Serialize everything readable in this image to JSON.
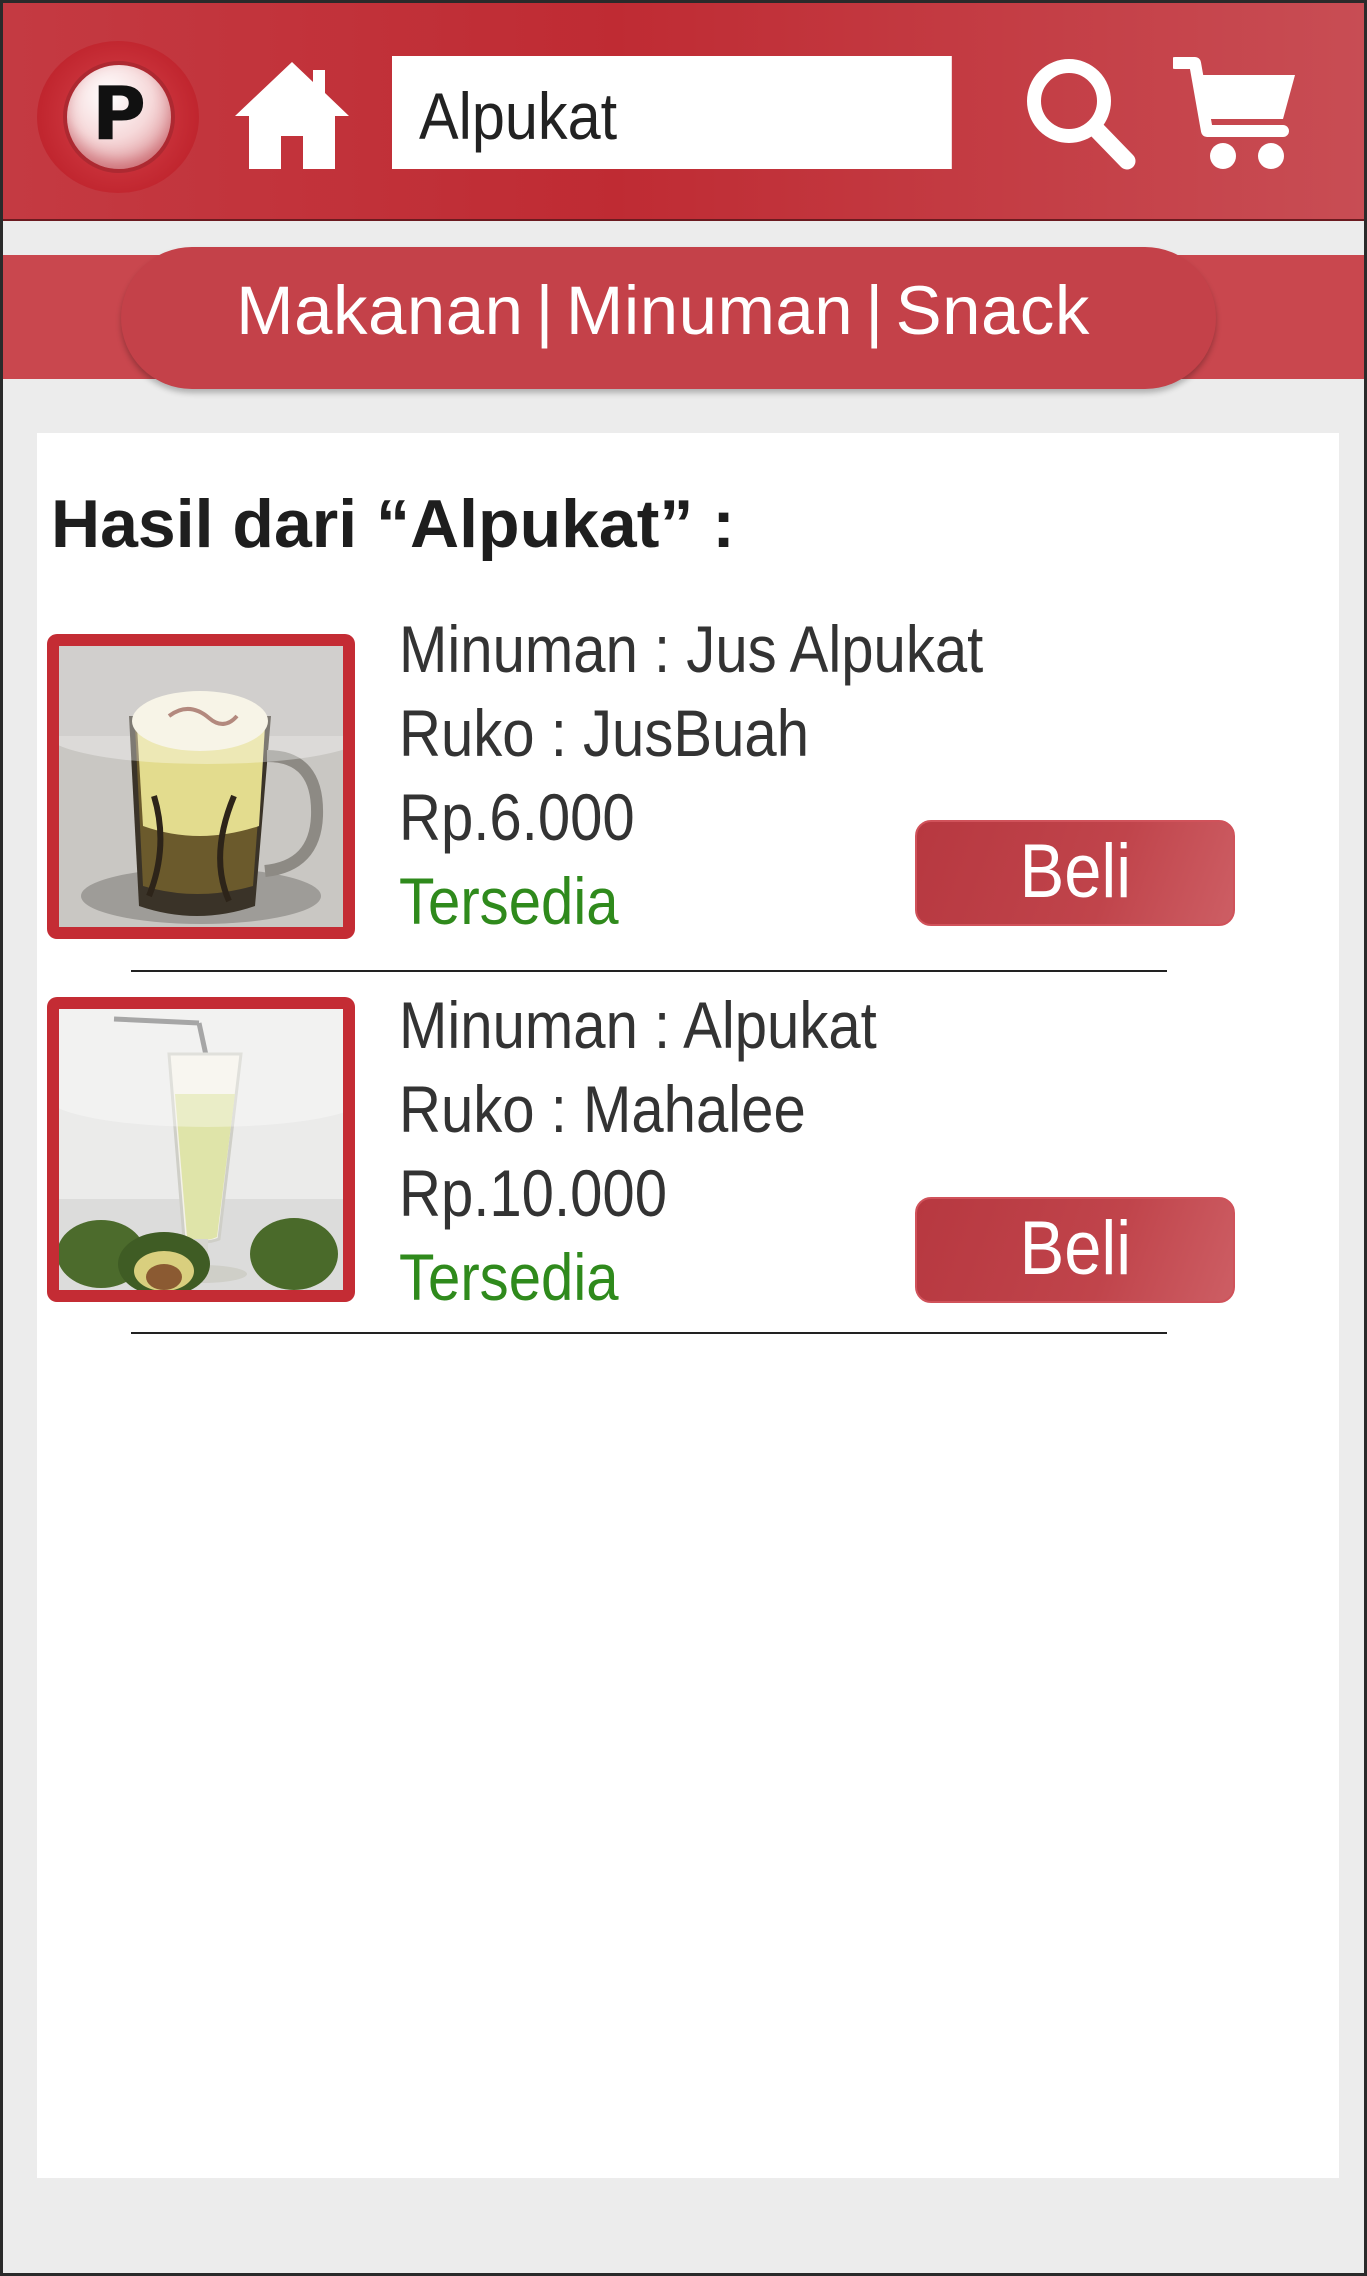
{
  "header": {
    "logo_letter": "P",
    "search": {
      "value": "Alpukat",
      "placeholder": ""
    },
    "icons": {
      "home": "home-icon",
      "search": "search-icon",
      "cart": "cart-icon"
    },
    "brand_color": "#c0272f"
  },
  "categories": {
    "items": [
      {
        "label": "Makanan"
      },
      {
        "label": "Minuman"
      },
      {
        "label": "Snack"
      }
    ],
    "separator": "|"
  },
  "results": {
    "title": "Hasil dari “Alpukat” :",
    "items": [
      {
        "product": "Minuman : Jus Alpukat",
        "store": "Ruko : JusBuah",
        "price": "Rp.6.000",
        "status": "Tersedia",
        "buy_label": "Beli",
        "image": "avocado-juice-mug"
      },
      {
        "product": "Minuman : Alpukat",
        "store": "Ruko : Mahalee",
        "price": "Rp.10.000",
        "status": "Tersedia",
        "buy_label": "Beli",
        "image": "avocado-juice-glass"
      }
    ]
  },
  "colors": {
    "status_available": "#2f8a1c",
    "button": "#bf3d45",
    "panel_bg": "#ececec"
  }
}
